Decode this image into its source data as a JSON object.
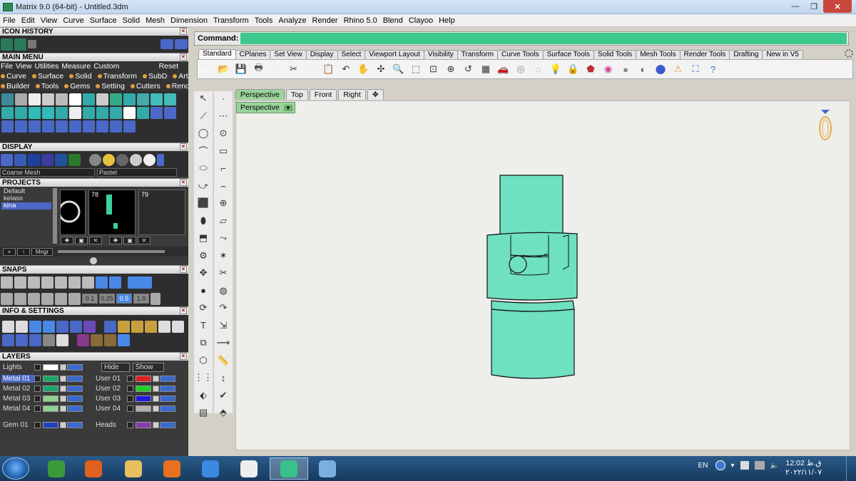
{
  "window": {
    "title": "Matrix 9.0 (64-bit) - Untitled.3dm",
    "min_label": "—",
    "max_label": "❐",
    "close_label": "✕"
  },
  "menubar": [
    "File",
    "Edit",
    "View",
    "Curve",
    "Surface",
    "Solid",
    "Mesh",
    "Dimension",
    "Transform",
    "Tools",
    "Analyze",
    "Render",
    "Rhino 5.0",
    "Blend",
    "Clayoo",
    "Help"
  ],
  "left_panel": {
    "icon_history_header": "ICON HISTORY",
    "main_menu_header": "MAIN MENU",
    "main_menu_row1": [
      "File",
      "View",
      "Utilities",
      "Measure",
      "Custom"
    ],
    "main_menu_reset": "Reset",
    "main_menu_row2": [
      "Curve",
      "Surface",
      "Solid",
      "Transform",
      "SubD",
      "Art"
    ],
    "main_menu_row3": [
      "Builder",
      "Tools",
      "Gems",
      "Setting",
      "Cutters",
      "Render"
    ],
    "display_header": "DISPLAY",
    "display_mesh": "Coarse Mesh",
    "display_style": "Pastel",
    "projects_header": "PROJECTS",
    "projects": [
      "Default",
      "kelass",
      "kina"
    ],
    "selected_project": "kina",
    "thumb_numbers": [
      "78",
      "79"
    ],
    "mngr_label": "Mngr",
    "snaps_header": "SNAPS",
    "snap_values": [
      "0.1",
      "0.25",
      "0.5",
      "1.0"
    ],
    "info_header": "INFO & SETTINGS",
    "layers_header": "LAYERS",
    "lights_label": "Lights",
    "hide_label": "Hide",
    "show_label": "Show",
    "layers_left": [
      {
        "name": "Metal 01",
        "color": "#1aa56a",
        "selected": true
      },
      {
        "name": "Metal 02",
        "color": "#1aa56a",
        "selected": false
      },
      {
        "name": "Metal 03",
        "color": "#8fd18f",
        "selected": false
      },
      {
        "name": "Metal 04",
        "color": "#8fd18f",
        "selected": false
      }
    ],
    "layers_right": [
      {
        "name": "User 01",
        "color": "#e02020"
      },
      {
        "name": "User 02",
        "color": "#20d020"
      },
      {
        "name": "User 03",
        "color": "#1a1ae0"
      },
      {
        "name": "User 04",
        "color": "#b0b0b0"
      }
    ],
    "layer_gem": {
      "name": "Gem 01",
      "color": "#2040c0"
    },
    "layer_heads": {
      "name": "Heads",
      "color": "#8a3ab0"
    }
  },
  "command": {
    "label": "Command:",
    "value": ""
  },
  "toolbar_tabs": [
    "Standard",
    "CPlanes",
    "Set View",
    "Display",
    "Select",
    "Viewport Layout",
    "Visibility",
    "Transform",
    "Curve Tools",
    "Surface Tools",
    "Solid Tools",
    "Mesh Tools",
    "Render Tools",
    "Drafting",
    "New in V5"
  ],
  "active_toolbar_tab": "Standard",
  "toolbar_icons": [
    "new-icon",
    "open-icon",
    "save-icon",
    "print-icon",
    "import-icon",
    "cut-icon",
    "copy-icon",
    "paste-icon",
    "undo-icon",
    "pan-icon",
    "rotate-view-icon",
    "zoom-icon",
    "zoom-window-icon",
    "zoom-extents-icon",
    "zoom-selected-icon",
    "undo-view-icon",
    "viewport-layout-icon",
    "car-icon",
    "capture-icon",
    "snap-icon",
    "light-icon",
    "lock-icon",
    "material-icon",
    "color-wheel-icon",
    "shade-icon",
    "render-icon",
    "rendered-icon",
    "spotlight-icon",
    "options-icon",
    "help-icon"
  ],
  "viewport_tabs": [
    "Perspective",
    "Top",
    "Front",
    "Right",
    "✥"
  ],
  "active_viewport": "Perspective",
  "viewport_label": "Perspective",
  "model_color": "#6fe0c0",
  "taskbar": {
    "apps": [
      "media-player-icon",
      "chrome-icon",
      "explorer-icon",
      "firefox-icon",
      "ie-icon",
      "inkscape-icon",
      "matrix-icon",
      "screen-icon"
    ],
    "lang": "EN",
    "clock_time": "12:02 ق.ظ",
    "clock_date": "۲۰۲۲/۱۱/۰۷"
  }
}
